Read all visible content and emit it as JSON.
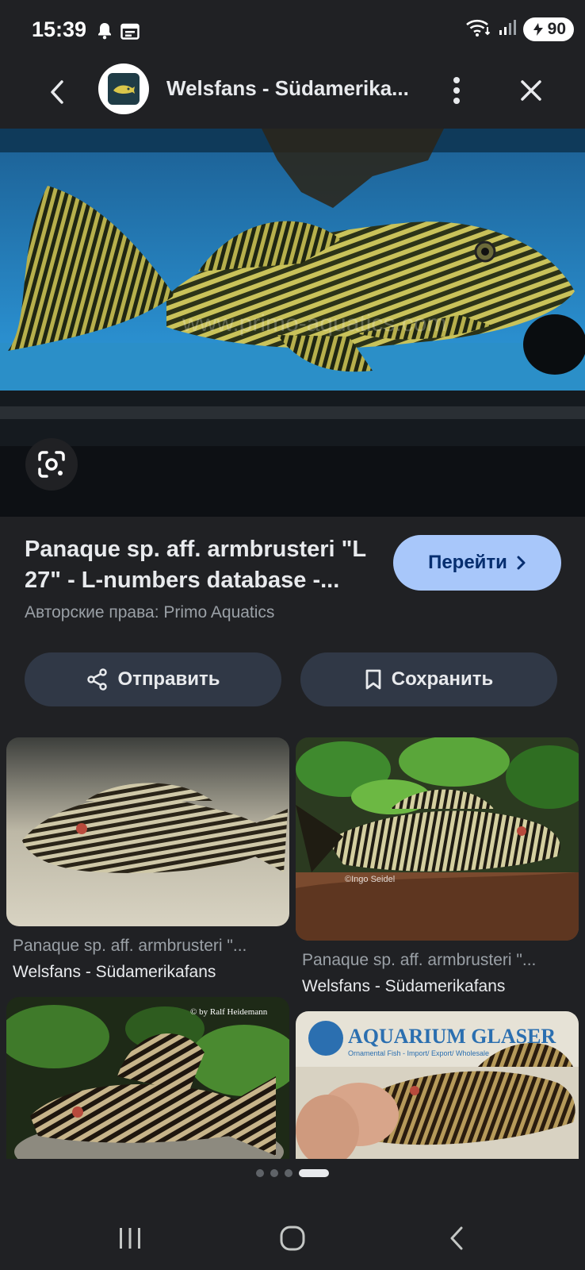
{
  "status_bar": {
    "time": "15:39",
    "battery": "90",
    "icons": [
      "bell-icon",
      "calendar-icon",
      "wifi-icon",
      "signal-icon"
    ]
  },
  "topbar": {
    "site_title": "Welsfans - Südamerika...",
    "icons": [
      "back-arrow-icon",
      "site-logo",
      "more-vert-icon",
      "close-icon"
    ]
  },
  "hero": {
    "watermark": "www.primo-aquatics.com",
    "lens_icon": "google-lens-icon"
  },
  "result": {
    "title": "Panaque sp. aff. armbrusteri \"L 27\" - L-numbers database -...",
    "copyright": "Авторские права: Primo Aquatics",
    "go_label": "Перейти"
  },
  "actions": {
    "share_label": "Отправить",
    "save_label": "Сохранить"
  },
  "related": [
    {
      "caption": "Panaque sp. aff. armbrusteri \"...",
      "source": "Welsfans - Südamerikafans"
    },
    {
      "caption": "Panaque sp. aff. armbrusteri \"...",
      "source": "Welsfans - Südamerikafans",
      "watermark": "©Ingo Seidel"
    },
    {
      "watermark": "© by Ralf Heidemann"
    },
    {
      "watermark_brand": "AQUARIUM GLASER",
      "watermark_sub": "Ornamental Fish - Import/ Export/ Wholesale"
    }
  ],
  "pagination": {
    "total": 4,
    "active": 3
  },
  "navbar": {
    "icons": [
      "recent-apps-icon",
      "home-icon",
      "back-icon"
    ]
  }
}
